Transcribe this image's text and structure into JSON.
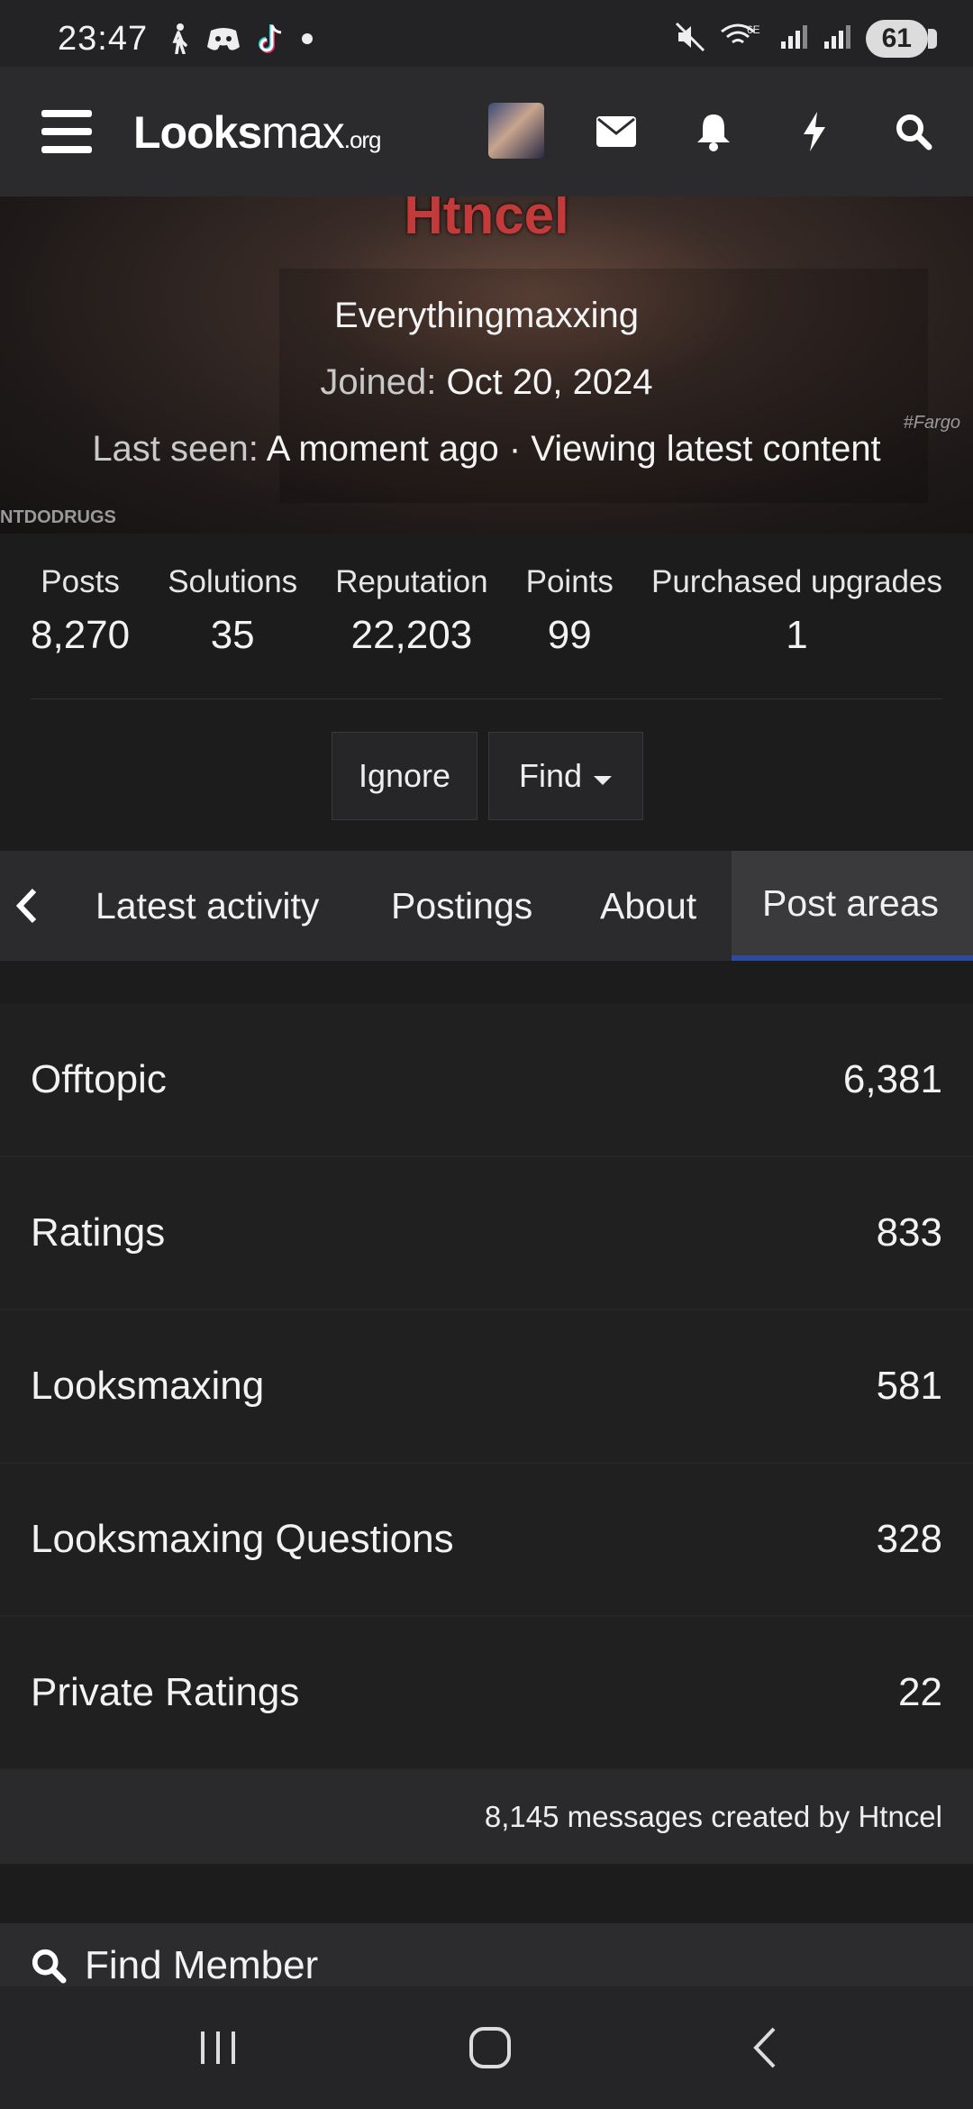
{
  "status_bar": {
    "time": "23:47",
    "battery": "61",
    "icons_left": [
      "walking-icon",
      "discord-icon",
      "tiktok-icon",
      "dot-icon"
    ],
    "icons_right": [
      "mute-icon",
      "wifi-6e-icon",
      "signal-icon",
      "signal-icon"
    ]
  },
  "header": {
    "logo_looks": "Looks",
    "logo_max": "max",
    "logo_org": ".org",
    "icons": [
      "menu-icon",
      "avatar",
      "mail-icon",
      "bell-icon",
      "bolt-icon",
      "search-icon"
    ]
  },
  "profile": {
    "username": "Htncel",
    "user_title": "Everythingmaxxing",
    "joined_label": "Joined:",
    "joined_value": "Oct 20, 2024",
    "last_seen_label": "Last seen:",
    "last_seen_value": "A moment ago · Viewing latest content",
    "watermark_left": "NTDODRUGS",
    "watermark_right": "#Fargo"
  },
  "stats": [
    {
      "label": "Posts",
      "value": "8,270"
    },
    {
      "label": "Solutions",
      "value": "35"
    },
    {
      "label": "Reputation",
      "value": "22,203"
    },
    {
      "label": "Points",
      "value": "99"
    },
    {
      "label": "Purchased upgrades",
      "value": "1"
    }
  ],
  "actions": {
    "ignore": "Ignore",
    "find": "Find"
  },
  "tabs": [
    {
      "label": "Latest activity"
    },
    {
      "label": "Postings"
    },
    {
      "label": "About"
    },
    {
      "label": "Post areas",
      "active": true
    }
  ],
  "post_areas": [
    {
      "name": "Offtopic",
      "count": "6,381"
    },
    {
      "name": "Ratings",
      "count": "833"
    },
    {
      "name": "Looksmaxing",
      "count": "581"
    },
    {
      "name": "Looksmaxing Questions",
      "count": "328"
    },
    {
      "name": "Private Ratings",
      "count": "22"
    }
  ],
  "messages_summary": "8,145 messages created by Htncel",
  "find_member": "Find Member",
  "colors": {
    "background": "#1c1c1d",
    "header": "#2b2b2d",
    "username": "#c23a3a",
    "active_tab_underline": "#2e4a9e"
  }
}
